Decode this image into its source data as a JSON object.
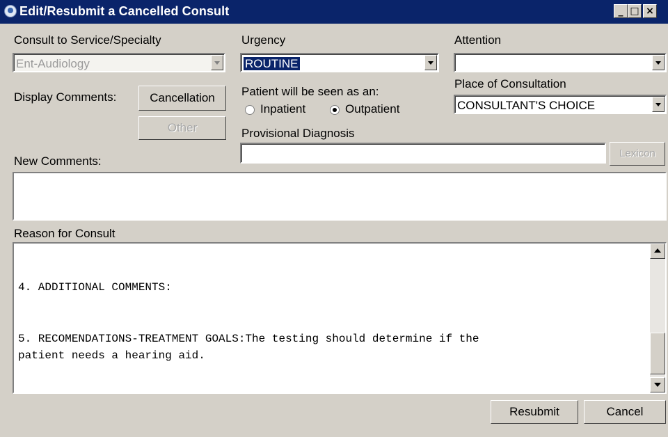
{
  "window": {
    "title": "Edit/Resubmit a Cancelled Consult"
  },
  "titlebar": {
    "min_glyph": "_",
    "max_glyph": "□",
    "close_glyph": "×"
  },
  "service": {
    "label": "Consult to Service/Specialty",
    "value": "Ent-Audiology"
  },
  "urgency": {
    "label": "Urgency",
    "value": "ROUTINE"
  },
  "attention": {
    "label": "Attention",
    "value": ""
  },
  "display_comments": {
    "label": "Display Comments:",
    "cancellation_button": "Cancellation",
    "other_button": "Other"
  },
  "patient_seen": {
    "label": "Patient will be seen as an:",
    "inpatient": "Inpatient",
    "outpatient": "Outpatient",
    "selected": "outpatient"
  },
  "place": {
    "label": "Place of Consultation",
    "value": "CONSULTANT'S CHOICE"
  },
  "provisional": {
    "label": "Provisional Diagnosis",
    "value": "",
    "lexicon_button": "Lexicon"
  },
  "new_comments": {
    "label": "New Comments:",
    "value": ""
  },
  "reason": {
    "label": "Reason for Consult",
    "lines": [
      "4. ADDITIONAL COMMENTS:",
      "5. RECOMENDATIONS-TREATMENT GOALS:The testing should determine if the",
      "patient needs a hearing aid."
    ]
  },
  "footer": {
    "resubmit_button": "Resubmit",
    "cancel_button": "Cancel"
  },
  "colors": {
    "titlebar": "#0a246a",
    "face": "#d4d0c8",
    "selection": "#0a246a"
  }
}
